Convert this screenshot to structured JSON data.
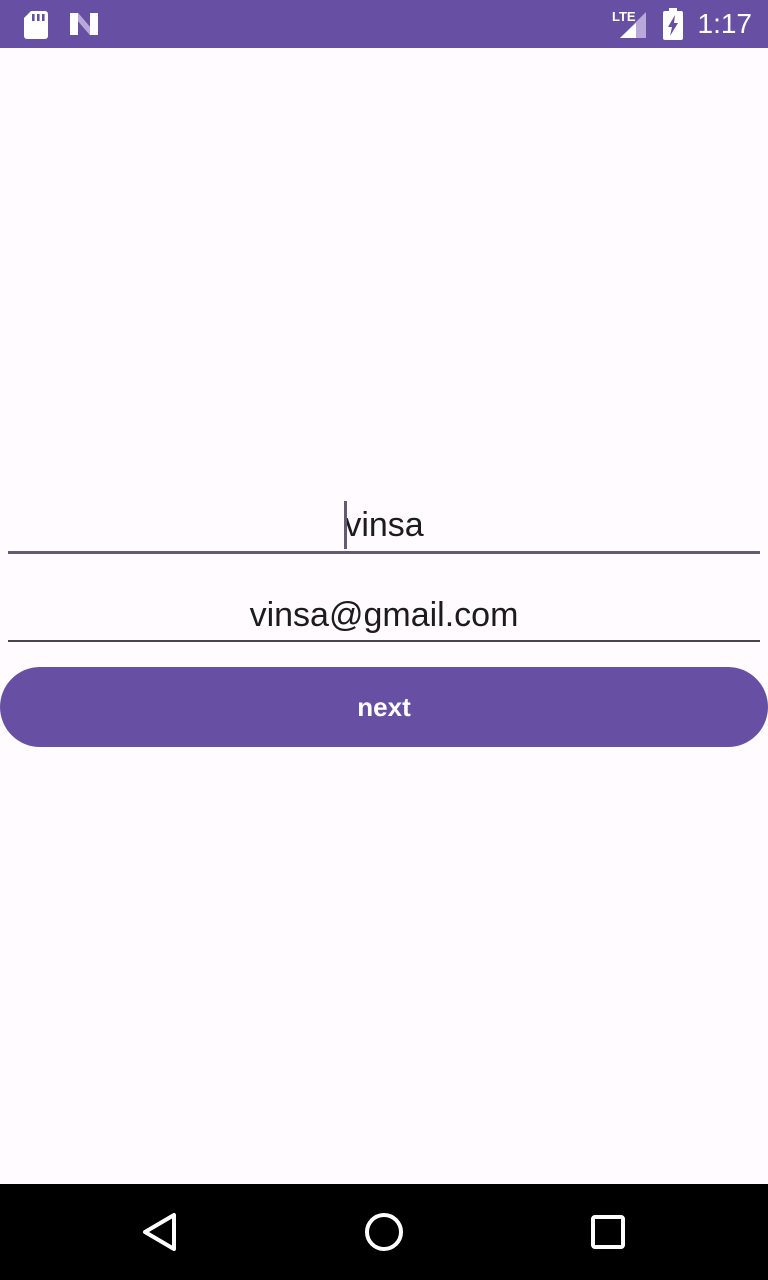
{
  "status_bar": {
    "time": "1:17",
    "network_label": "LTE",
    "icons": [
      "sd-card-icon",
      "n-logo-icon",
      "lte-signal-icon",
      "battery-charging-icon"
    ],
    "background_color": "#6750A4"
  },
  "form": {
    "name_value": "vinsa",
    "email_value": "vinsa@gmail.com",
    "next_label": "next"
  },
  "nav_bar": {
    "icons": [
      "back-icon",
      "home-icon",
      "recents-icon"
    ]
  },
  "colors": {
    "accent": "#6750A4",
    "background": "#FFFBFE",
    "text": "#1C1B1F"
  }
}
